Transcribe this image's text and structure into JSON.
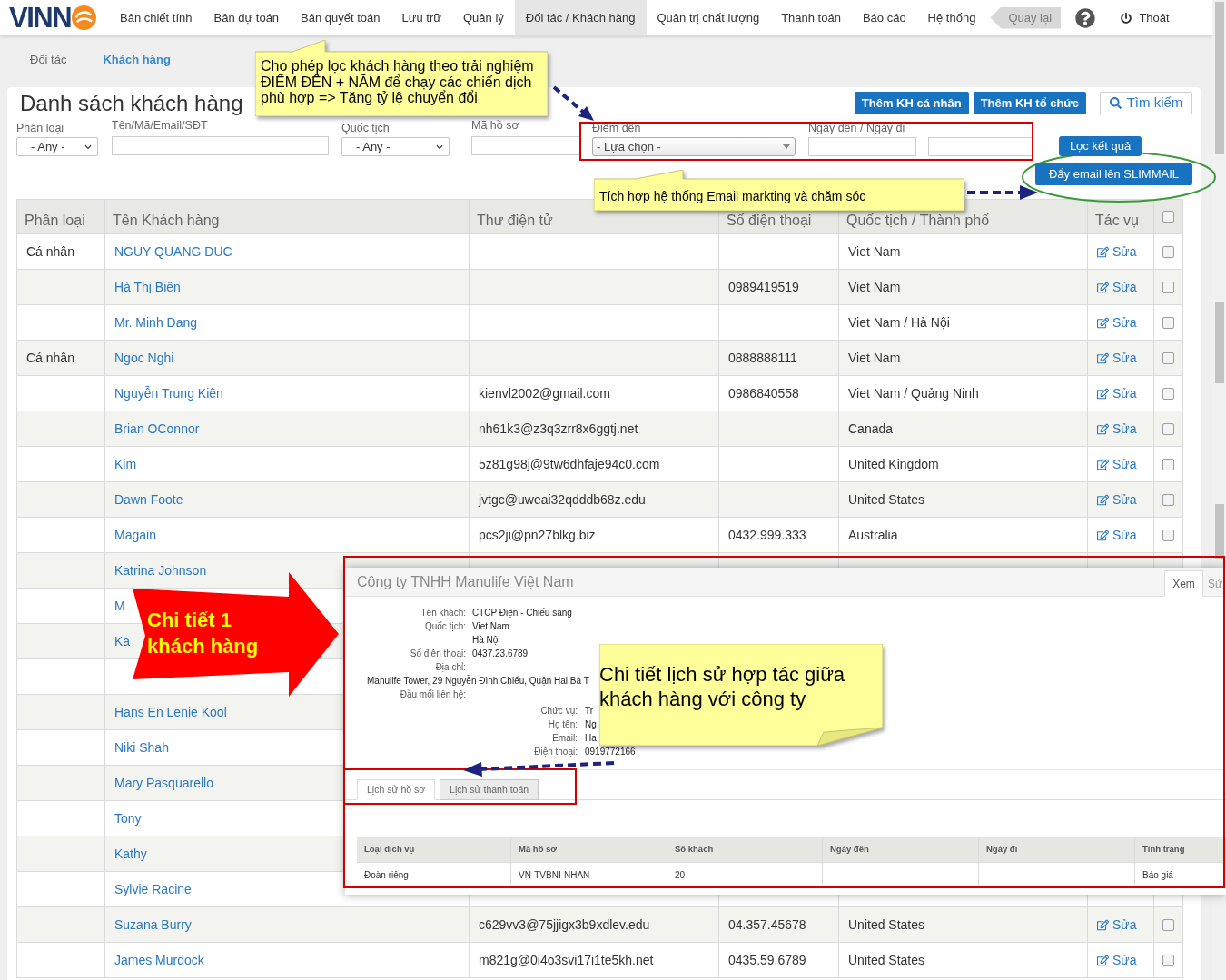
{
  "nav": {
    "logo": "VINN",
    "items": [
      {
        "label": "Bản chiết tính",
        "selected": false
      },
      {
        "label": "Bản dự toán",
        "selected": false
      },
      {
        "label": "Bản quyết toán",
        "selected": false
      },
      {
        "label": "Lưu trữ",
        "selected": false
      },
      {
        "label": "Quản lý",
        "selected": false
      },
      {
        "label": "Đối tác / Khách hàng",
        "selected": true
      },
      {
        "label": "Quản trị chất lượng",
        "selected": false
      },
      {
        "label": "Thanh toán",
        "selected": false
      },
      {
        "label": "Báo cáo",
        "selected": false
      },
      {
        "label": "Hệ thống",
        "selected": false
      }
    ],
    "back": "Quay lại",
    "logout": "Thoát"
  },
  "subnav": [
    {
      "label": "Đối tác",
      "selected": false
    },
    {
      "label": "Khách hàng",
      "selected": true
    }
  ],
  "page": {
    "title": "Danh sách khách hàng",
    "buttons": [
      {
        "kind": "primary",
        "label": "Thêm KH cá nhân"
      },
      {
        "kind": "primary",
        "label": "Thêm KH tổ chức"
      },
      {
        "kind": "search",
        "label": "Tìm kiếm"
      }
    ]
  },
  "filters": [
    {
      "kind": "select",
      "label": "Phân loại",
      "value": "- Any -"
    },
    {
      "kind": "text",
      "label": "Tên/Mã/Email/SĐT"
    },
    {
      "kind": "select",
      "label": "Quốc tịch",
      "value": "- Any -"
    },
    {
      "kind": "text",
      "label": "Mã hồ sơ"
    },
    {
      "kind": "combo",
      "label": "Điểm đến",
      "value": "- Lựa chọn -"
    },
    {
      "kind": "date_range",
      "label": "Ngày đến / Ngày đi"
    }
  ],
  "filter_button": "Lọc kết quả",
  "email_button": "Đẩy email lên SLIMMAIL",
  "table": {
    "columns": [
      "Phân loại",
      "Tên Khách hàng",
      "Thư điện tử",
      "Số điện thoại",
      "Quốc tịch / Thành phố",
      "Tác vụ"
    ],
    "select_all": {
      "checked": false
    },
    "rows": [
      {
        "type": "Cá nhân",
        "name": "NGUY QUANG DUC",
        "location": "Viet Nam",
        "action": "Sửa",
        "checked": false
      },
      {
        "name": "Hà Thị Biên",
        "phone": "0989419519",
        "location": "Viet Nam",
        "action": "Sửa",
        "checked": false
      },
      {
        "name": "Mr. Minh Dang",
        "location": "Viet Nam / Hà Nội",
        "action": "Sửa",
        "checked": false
      },
      {
        "type": "Cá nhân",
        "name": "Ngoc Nghi",
        "phone": "0888888111",
        "location": "Viet Nam",
        "action": "Sửa",
        "checked": false
      },
      {
        "name": "Nguyễn Trung Kiên",
        "email": "kienvl2002@gmail.com",
        "phone": "0986840558",
        "location": "Viet Nam / Quảng Ninh",
        "action": "Sửa",
        "checked": false
      },
      {
        "name": "Brian OConnor",
        "email": "nh61k3@z3q3zrr8x6ggtj.net",
        "location": "Canada",
        "action": "Sửa",
        "checked": false
      },
      {
        "name": "Kim",
        "email": "5z81g98j@9tw6dhfaje94c0.com",
        "location": "United Kingdom",
        "action": "Sửa",
        "checked": false
      },
      {
        "name": "Dawn Foote",
        "email": "jvtgc@uweai32qdddb68z.edu",
        "location": "United States",
        "action": "Sửa",
        "checked": false
      },
      {
        "name": "Magain",
        "email": "pcs2ji@pn27blkg.biz",
        "phone": "0432.999.333",
        "location": "Australia",
        "action": "Sửa",
        "checked": false
      },
      {
        "name": "Katrina Johnson"
      },
      {
        "name": "M"
      },
      {
        "name": "Ka"
      },
      {},
      {
        "name": "Hans En Lenie Kool"
      },
      {
        "name": "Niki Shah"
      },
      {
        "name": "Mary Pasquarello"
      },
      {
        "name": "Tony"
      },
      {
        "name": "Kathy"
      },
      {
        "name": "Sylvie Racine"
      },
      {
        "name": "Suzana Burry",
        "email": "c629vv3@75jjigx3b9xdlev.edu",
        "phone": "04.357.45678",
        "location": "United States",
        "action": "Sửa",
        "checked": false
      },
      {
        "name": "James Murdock",
        "email": "m821g@0i4o3svi17i1te5kh.net",
        "phone": "0435.59.6789",
        "location": "United States",
        "action": "Sửa",
        "checked": false
      }
    ]
  },
  "detail_popup": {
    "title": "Công ty TNHH Manulife Việt Nam",
    "tabs": [
      {
        "label": "Xem",
        "selected": true
      },
      {
        "label": "Sử",
        "selected": false
      }
    ],
    "fields": [
      {
        "kind": "pair",
        "label": "Tên khách:",
        "value": "CTCP Điện - Chiếu sáng"
      },
      {
        "kind": "pair",
        "label": "Quốc tịch:",
        "value": "Viet Nam"
      },
      {
        "kind": "pair",
        "value": "Hà Nội"
      },
      {
        "kind": "pair",
        "label": "Số điện thoại:",
        "value": "0437.23.6789"
      },
      {
        "kind": "pair",
        "label": "Địa chỉ:"
      },
      {
        "kind": "line",
        "value": "Manulife Tower, 29 Nguyễn Đình Chiểu, Quận Hai Bà T"
      },
      {
        "kind": "pair",
        "label": "Đầu mối liên hệ:"
      }
    ],
    "contact": [
      {
        "label": "Chức vụ:",
        "value": "Tr"
      },
      {
        "label": "Họ tên:",
        "value": "Ng"
      },
      {
        "label": "Email:",
        "value": "Ha"
      },
      {
        "label": "Điện thoại:",
        "value": "0919772166"
      }
    ],
    "history_tabs": [
      {
        "label": "Lịch sử hồ sơ",
        "selected": true
      },
      {
        "label": "Lịch sử thanh toán",
        "selected": false
      }
    ],
    "history_table": {
      "columns": [
        "Loại dịch vụ",
        "Mã hồ sơ",
        "Số khách",
        "Ngày đến",
        "Ngày đi",
        "Tình trạng"
      ],
      "rows": [
        [
          "Đoàn riêng",
          "VN-TVBNI-NHAN",
          "20",
          null,
          null,
          "Báo giá"
        ]
      ]
    }
  },
  "callouts": [
    {
      "kind": "note",
      "lines": [
        "Cho phép lọc khách hàng theo trải nghiệm",
        "ĐIỂM ĐẾN + NĂM để chạy các chiến dịch",
        "phù hợp => Tăng tỷ lệ chuyển đổi"
      ]
    },
    {
      "kind": "note",
      "lines": [
        "Tích hợp hệ thống Email markting và chăm sóc"
      ]
    },
    {
      "kind": "arrow",
      "lines": [
        "Chi tiết 1",
        "khách hàng"
      ]
    },
    {
      "kind": "note",
      "lines": [
        "Chi tiết lịch sử hợp tác giữa",
        "khách hàng với công ty"
      ]
    }
  ]
}
